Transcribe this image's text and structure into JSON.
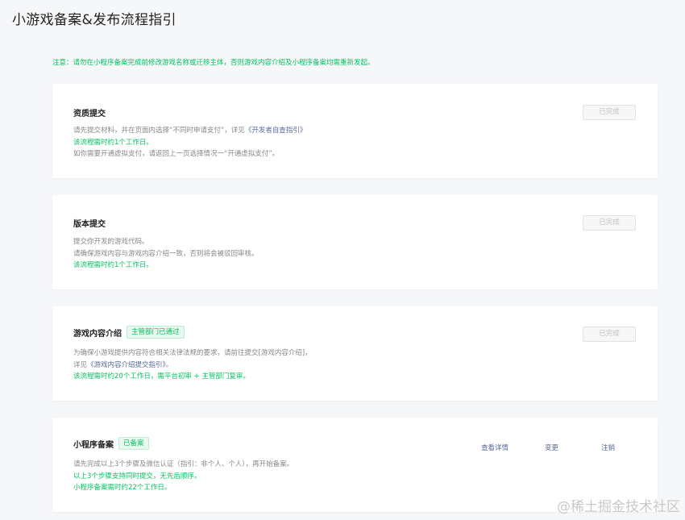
{
  "page": {
    "title": "小游戏备案&发布流程指引",
    "notice": "注意：请勿在小程序备案完成前修改游戏名称或迁移主体，否则游戏内容介绍及小程序备案均需重新发起。"
  },
  "cards": [
    {
      "title": "资质提交",
      "badge": "",
      "button": "已完成",
      "lines": {
        "l1_pre": "请先提交材料，并在页面内选择“不同时申请支付”，详见",
        "l1_link": "《开发者自查指引》",
        "l2": "该流程需时约1个工作日。",
        "l3": "如你需要开通虚拟支付，请返回上一页选择情况一“开通虚拟支付”。"
      }
    },
    {
      "title": "版本提交",
      "badge": "",
      "button": "已完成",
      "lines": {
        "l1": "提交你开发的游戏代码。",
        "l2": "请确保游戏内容与游戏内容介绍一致，否则将会被驳回审核。",
        "l3": "该流程需时约1个工作日。"
      }
    },
    {
      "title": "游戏内容介绍",
      "badge": "主管部门已通过",
      "button": "已完成",
      "lines": {
        "l1": "为确保小游戏提供内容符合相关法律法规的要求，请前往提交[游戏内容介绍]，",
        "l2_pre": "详见",
        "l2_link": "《游戏内容介绍提交指引》",
        "l2_post": "。",
        "l3": "该流程需时约20个工作日，需平台初审 + 主管部门复审。"
      }
    },
    {
      "title": "小程序备案",
      "badge": "已备案",
      "actions": {
        "view": "查看详情",
        "change": "变更",
        "cancel": "注销"
      },
      "lines": {
        "l1": "请先完成以上3个步骤及微信认证（指引：非个人、个人），再开始备案。",
        "l2": "以上3个步骤支持同时提交，无先后顺序。",
        "l3": "小程序备案需时约22个工作日。"
      }
    }
  ],
  "watermark": "@稀土掘金技术社区"
}
